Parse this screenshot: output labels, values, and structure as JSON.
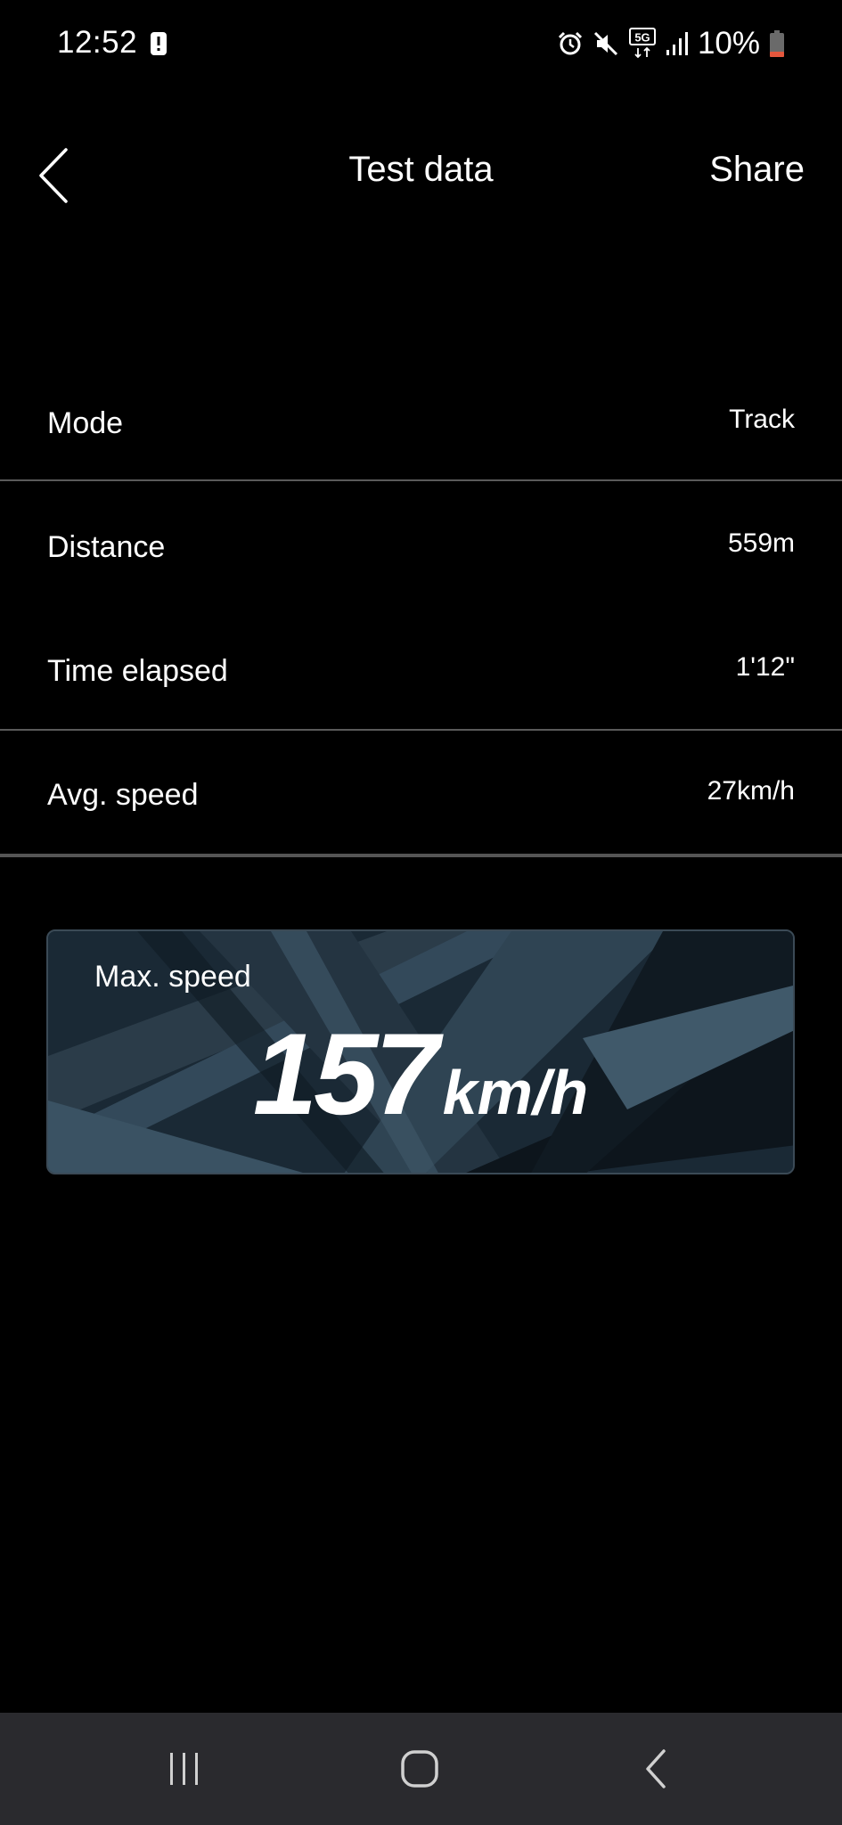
{
  "status_bar": {
    "time": "12:52",
    "network": "5G",
    "battery": "10%",
    "icons": [
      "alert-icon",
      "alarm-icon",
      "mute-icon",
      "5g-icon",
      "signal-icon",
      "battery-icon"
    ]
  },
  "header": {
    "title": "Test data",
    "share_label": "Share",
    "back_icon": "chevron-left-icon"
  },
  "rows": [
    {
      "label": "Mode",
      "value": "Track"
    },
    {
      "label": "Distance",
      "value": "559m"
    },
    {
      "label": "Time elapsed",
      "value": "1'12\""
    },
    {
      "label": "Avg. speed",
      "value": "27km/h"
    }
  ],
  "max_speed": {
    "label": "Max. speed",
    "value": "157",
    "unit": "km/h"
  },
  "nav_bar": {
    "icons": [
      "recents-icon",
      "home-icon",
      "back-icon"
    ]
  },
  "colors": {
    "background": "#000000",
    "text": "#ffffff",
    "divider": "#5a5a5a",
    "card": "#1c2b37",
    "nav_bar": "#2a2a2e",
    "battery_low": "#e4573d"
  }
}
